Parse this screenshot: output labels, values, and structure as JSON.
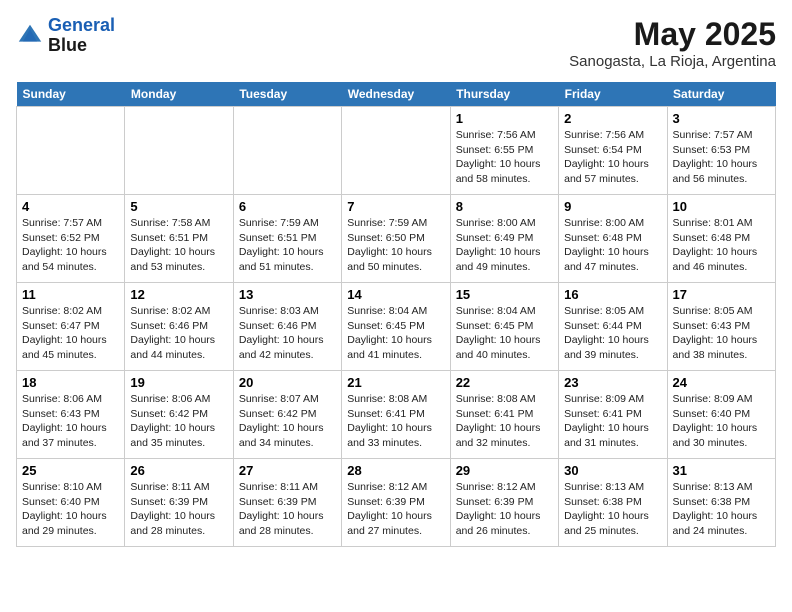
{
  "header": {
    "logo_line1": "General",
    "logo_line2": "Blue",
    "title": "May 2025",
    "subtitle": "Sanogasta, La Rioja, Argentina"
  },
  "days_of_week": [
    "Sunday",
    "Monday",
    "Tuesday",
    "Wednesday",
    "Thursday",
    "Friday",
    "Saturday"
  ],
  "weeks": [
    {
      "cells": [
        {
          "day": null
        },
        {
          "day": null
        },
        {
          "day": null
        },
        {
          "day": null
        },
        {
          "day": "1",
          "sunrise": "Sunrise: 7:56 AM",
          "sunset": "Sunset: 6:55 PM",
          "daylight": "Daylight: 10 hours and 58 minutes."
        },
        {
          "day": "2",
          "sunrise": "Sunrise: 7:56 AM",
          "sunset": "Sunset: 6:54 PM",
          "daylight": "Daylight: 10 hours and 57 minutes."
        },
        {
          "day": "3",
          "sunrise": "Sunrise: 7:57 AM",
          "sunset": "Sunset: 6:53 PM",
          "daylight": "Daylight: 10 hours and 56 minutes."
        }
      ]
    },
    {
      "cells": [
        {
          "day": "4",
          "sunrise": "Sunrise: 7:57 AM",
          "sunset": "Sunset: 6:52 PM",
          "daylight": "Daylight: 10 hours and 54 minutes."
        },
        {
          "day": "5",
          "sunrise": "Sunrise: 7:58 AM",
          "sunset": "Sunset: 6:51 PM",
          "daylight": "Daylight: 10 hours and 53 minutes."
        },
        {
          "day": "6",
          "sunrise": "Sunrise: 7:59 AM",
          "sunset": "Sunset: 6:51 PM",
          "daylight": "Daylight: 10 hours and 51 minutes."
        },
        {
          "day": "7",
          "sunrise": "Sunrise: 7:59 AM",
          "sunset": "Sunset: 6:50 PM",
          "daylight": "Daylight: 10 hours and 50 minutes."
        },
        {
          "day": "8",
          "sunrise": "Sunrise: 8:00 AM",
          "sunset": "Sunset: 6:49 PM",
          "daylight": "Daylight: 10 hours and 49 minutes."
        },
        {
          "day": "9",
          "sunrise": "Sunrise: 8:00 AM",
          "sunset": "Sunset: 6:48 PM",
          "daylight": "Daylight: 10 hours and 47 minutes."
        },
        {
          "day": "10",
          "sunrise": "Sunrise: 8:01 AM",
          "sunset": "Sunset: 6:48 PM",
          "daylight": "Daylight: 10 hours and 46 minutes."
        }
      ]
    },
    {
      "cells": [
        {
          "day": "11",
          "sunrise": "Sunrise: 8:02 AM",
          "sunset": "Sunset: 6:47 PM",
          "daylight": "Daylight: 10 hours and 45 minutes."
        },
        {
          "day": "12",
          "sunrise": "Sunrise: 8:02 AM",
          "sunset": "Sunset: 6:46 PM",
          "daylight": "Daylight: 10 hours and 44 minutes."
        },
        {
          "day": "13",
          "sunrise": "Sunrise: 8:03 AM",
          "sunset": "Sunset: 6:46 PM",
          "daylight": "Daylight: 10 hours and 42 minutes."
        },
        {
          "day": "14",
          "sunrise": "Sunrise: 8:04 AM",
          "sunset": "Sunset: 6:45 PM",
          "daylight": "Daylight: 10 hours and 41 minutes."
        },
        {
          "day": "15",
          "sunrise": "Sunrise: 8:04 AM",
          "sunset": "Sunset: 6:45 PM",
          "daylight": "Daylight: 10 hours and 40 minutes."
        },
        {
          "day": "16",
          "sunrise": "Sunrise: 8:05 AM",
          "sunset": "Sunset: 6:44 PM",
          "daylight": "Daylight: 10 hours and 39 minutes."
        },
        {
          "day": "17",
          "sunrise": "Sunrise: 8:05 AM",
          "sunset": "Sunset: 6:43 PM",
          "daylight": "Daylight: 10 hours and 38 minutes."
        }
      ]
    },
    {
      "cells": [
        {
          "day": "18",
          "sunrise": "Sunrise: 8:06 AM",
          "sunset": "Sunset: 6:43 PM",
          "daylight": "Daylight: 10 hours and 37 minutes."
        },
        {
          "day": "19",
          "sunrise": "Sunrise: 8:06 AM",
          "sunset": "Sunset: 6:42 PM",
          "daylight": "Daylight: 10 hours and 35 minutes."
        },
        {
          "day": "20",
          "sunrise": "Sunrise: 8:07 AM",
          "sunset": "Sunset: 6:42 PM",
          "daylight": "Daylight: 10 hours and 34 minutes."
        },
        {
          "day": "21",
          "sunrise": "Sunrise: 8:08 AM",
          "sunset": "Sunset: 6:41 PM",
          "daylight": "Daylight: 10 hours and 33 minutes."
        },
        {
          "day": "22",
          "sunrise": "Sunrise: 8:08 AM",
          "sunset": "Sunset: 6:41 PM",
          "daylight": "Daylight: 10 hours and 32 minutes."
        },
        {
          "day": "23",
          "sunrise": "Sunrise: 8:09 AM",
          "sunset": "Sunset: 6:41 PM",
          "daylight": "Daylight: 10 hours and 31 minutes."
        },
        {
          "day": "24",
          "sunrise": "Sunrise: 8:09 AM",
          "sunset": "Sunset: 6:40 PM",
          "daylight": "Daylight: 10 hours and 30 minutes."
        }
      ]
    },
    {
      "cells": [
        {
          "day": "25",
          "sunrise": "Sunrise: 8:10 AM",
          "sunset": "Sunset: 6:40 PM",
          "daylight": "Daylight: 10 hours and 29 minutes."
        },
        {
          "day": "26",
          "sunrise": "Sunrise: 8:11 AM",
          "sunset": "Sunset: 6:39 PM",
          "daylight": "Daylight: 10 hours and 28 minutes."
        },
        {
          "day": "27",
          "sunrise": "Sunrise: 8:11 AM",
          "sunset": "Sunset: 6:39 PM",
          "daylight": "Daylight: 10 hours and 28 minutes."
        },
        {
          "day": "28",
          "sunrise": "Sunrise: 8:12 AM",
          "sunset": "Sunset: 6:39 PM",
          "daylight": "Daylight: 10 hours and 27 minutes."
        },
        {
          "day": "29",
          "sunrise": "Sunrise: 8:12 AM",
          "sunset": "Sunset: 6:39 PM",
          "daylight": "Daylight: 10 hours and 26 minutes."
        },
        {
          "day": "30",
          "sunrise": "Sunrise: 8:13 AM",
          "sunset": "Sunset: 6:38 PM",
          "daylight": "Daylight: 10 hours and 25 minutes."
        },
        {
          "day": "31",
          "sunrise": "Sunrise: 8:13 AM",
          "sunset": "Sunset: 6:38 PM",
          "daylight": "Daylight: 10 hours and 24 minutes."
        }
      ]
    }
  ]
}
